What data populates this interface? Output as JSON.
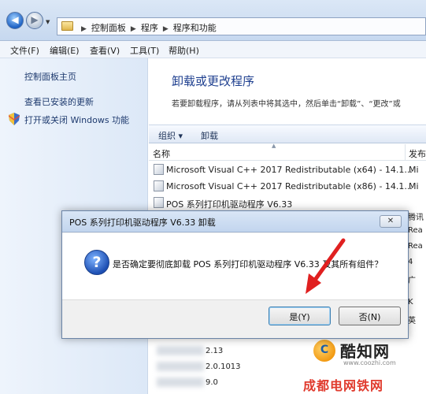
{
  "address_bar": {
    "crumbs": [
      "控制面板",
      "程序",
      "程序和功能"
    ],
    "back_glyph": "◀",
    "forward_glyph": "▶"
  },
  "menu": {
    "file": "文件(F)",
    "edit": "编辑(E)",
    "view": "查看(V)",
    "tools": "工具(T)",
    "help": "帮助(H)"
  },
  "sidebar": {
    "home": "控制面板主页",
    "installed_updates": "查看已安装的更新",
    "windows_features": "打开或关闭 Windows 功能"
  },
  "main": {
    "title": "卸载或更改程序",
    "description": "若要卸载程序，请从列表中将其选中，然后单击“卸载”、“更改”或"
  },
  "toolbar": {
    "organize": "组织 ▾",
    "uninstall": "卸载"
  },
  "columns": {
    "name": "名称",
    "publisher": "发布"
  },
  "programs": [
    {
      "name": "Microsoft Visual C++ 2017 Redistributable (x64) - 14.1...",
      "publisher": "Mi"
    },
    {
      "name": "Microsoft Visual C++ 2017 Redistributable (x86) - 14.1...",
      "publisher": "Mi"
    },
    {
      "name": "POS 系列打印机驱动程序 V6.33",
      "publisher": ""
    }
  ],
  "right_column_fragments": [
    "腾讯",
    "Rea",
    "Rea",
    "4",
    "广",
    "K",
    "英"
  ],
  "blurred_rows": [
    "2.13",
    "2.0.1013",
    "9.0"
  ],
  "dialog": {
    "title": "POS 系列打印机驱动程序 V6.33 卸载",
    "close_glyph": "✕",
    "question_glyph": "?",
    "message": "是否确定要彻底卸载 POS 系列打印机驱动程序 V6.33 及其所有组件？",
    "yes_label": "是(Y)",
    "no_label": "否(N)"
  },
  "watermark": {
    "logo_glyph": "C",
    "site_name": "酷知网",
    "site_url": "www.coozhi.com",
    "bottom_text": "成都电网铁网"
  },
  "colors": {
    "accent": "#1e3f8f",
    "annotation_arrow": "#e02020"
  }
}
